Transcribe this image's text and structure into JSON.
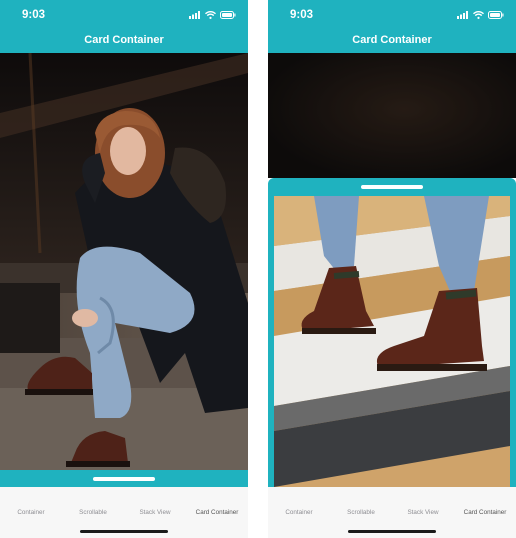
{
  "status": {
    "time": "9:03"
  },
  "header": {
    "title": "Card Container"
  },
  "tabs": [
    {
      "label": "Container",
      "active": false
    },
    {
      "label": "Scrollable",
      "active": false
    },
    {
      "label": "Stack View",
      "active": false
    },
    {
      "label": "Card Container",
      "active": true
    }
  ],
  "colors": {
    "accent": "#1fb2bf",
    "tab_bar": "#f7f7f7",
    "tab_text": "#8e8e93"
  },
  "icons": [
    "signal-icon",
    "wifi-icon",
    "battery-icon"
  ]
}
